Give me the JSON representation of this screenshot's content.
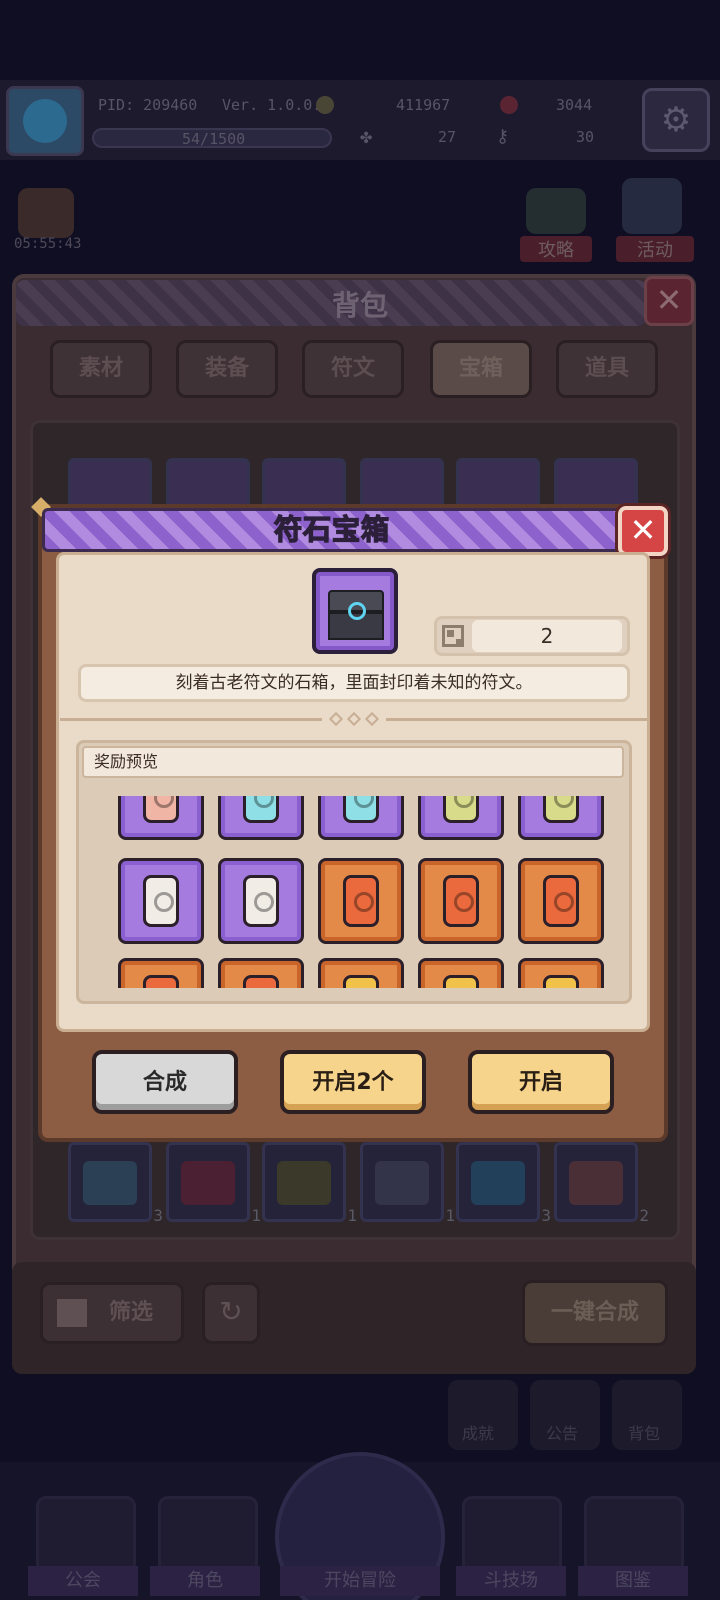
{
  "hud": {
    "pid": "PID: 209460",
    "version": "Ver. 1.0.0.3",
    "gold": "411967",
    "gems": "3044",
    "stamina": "54/1500",
    "clover": "27",
    "keys": "30",
    "timer": "05:55:43",
    "strategy_label": "攻略",
    "event_label": "活动"
  },
  "backpack": {
    "title": "背包",
    "tabs": [
      {
        "label": "素材"
      },
      {
        "label": "装备"
      },
      {
        "label": "符文"
      },
      {
        "label": "宝箱"
      },
      {
        "label": "道具"
      }
    ],
    "bottom_row_counts": [
      "3",
      "1",
      "1",
      "1",
      "3",
      "2"
    ],
    "filter_label": "筛选",
    "merge_all_label": "一键合成"
  },
  "side_menu": {
    "achievement": "成就",
    "notice": "公告",
    "bag": "背包"
  },
  "bottom_nav": {
    "guild": "公会",
    "character": "角色",
    "adventure": "开始冒险",
    "arena": "斗技场",
    "codex": "图鉴"
  },
  "dialog": {
    "title": "符石宝箱",
    "owned_count": "2",
    "description": "刻着古老符文的石箱，里面封印着未知的符文。",
    "reward_preview_label": "奖励预览",
    "buttons": {
      "merge": "合成",
      "open_multi": "开启2个",
      "open": "开启"
    }
  },
  "colors": {
    "dialog_header": "#9a72d6",
    "close_button": "#d64545",
    "rarity_purple": "#a57be0",
    "rarity_orange": "#e48a48",
    "button_gold": "#f6d48c",
    "button_gray": "#d8d8d8"
  }
}
